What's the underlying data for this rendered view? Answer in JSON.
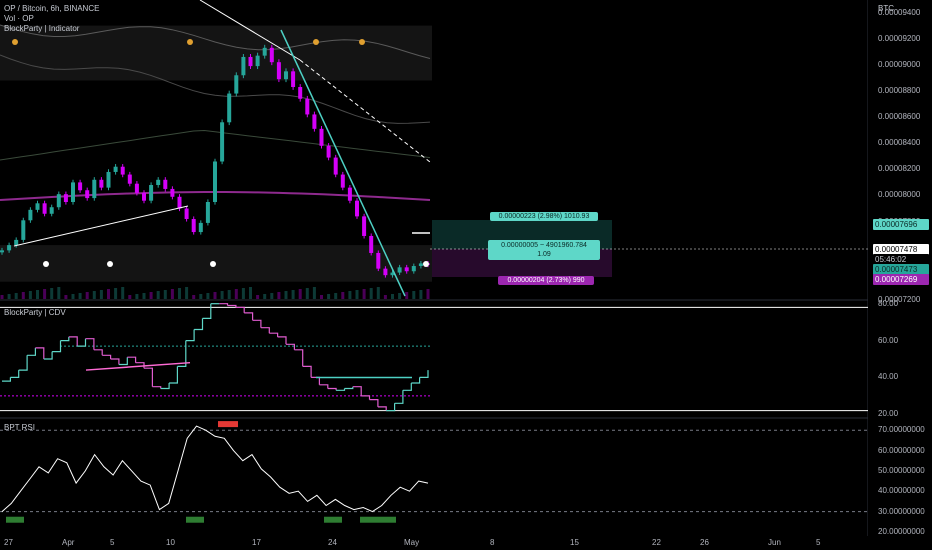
{
  "header": {
    "symbol": "OP / Bitcoin, 6h, BINANCE",
    "vol_label": "Vol · OP",
    "indicator_label": "BlockParty | Indicator",
    "currency": "BTC"
  },
  "panes": {
    "cdv_title": "BlockParty | CDV",
    "rsi_title": "BPT RSI"
  },
  "colors": {
    "bull": "#26a69a",
    "bear": "#d500f9",
    "rsi_line": "#ffffff",
    "trend_teal": "#4dd0c4",
    "ma_purple": "#8e2a8e",
    "cdv_bull": "#5ed7c8",
    "cdv_bear": "#e05ccf"
  },
  "price_axis": {
    "ticks": [
      "0.00009400",
      "0.00009200",
      "0.00009000",
      "0.00008800",
      "0.00008600",
      "0.00008400",
      "0.00008200",
      "0.00008000",
      "0.00007800",
      "0.00007600",
      "0.00007400",
      "0.00007200"
    ],
    "tags": {
      "upper_target": "0.00007696",
      "last": "0.00007478",
      "countdown": "05:46:02",
      "entry": "0.00007473",
      "stop": "0.00007269"
    }
  },
  "cdv_axis": {
    "ticks": [
      "80.00",
      "60.00",
      "40.00",
      "20.00"
    ]
  },
  "rsi_axis": {
    "ticks": [
      "70.00000000",
      "60.00000000",
      "50.00000000",
      "40.00000000",
      "30.00000000",
      "20.00000000"
    ]
  },
  "time_axis": {
    "labels": [
      "27",
      "Apr",
      "5",
      "10",
      "17",
      "24",
      "May",
      "8",
      "15",
      "22",
      "26",
      "Jun",
      "5"
    ]
  },
  "position_tool": {
    "target_text": "0.00000223 (2.98%) 1010.93",
    "center_line1": "0.00000005 ~ 4901960.784",
    "center_line2": "1.09",
    "stop_text": "0.00000204 (2.73%) 990"
  },
  "chart_data": [
    {
      "type": "line",
      "title": "OP / Bitcoin, 6h, BINANCE",
      "series": [
        {
          "name": "OP / Bitcoin",
          "values": [
            7.58e-05,
            7.62e-05,
            7.66e-05,
            7.81e-05,
            7.89e-05,
            7.94e-05,
            7.86e-05,
            7.91e-05,
            8.01e-05,
            7.95e-05,
            8.1e-05,
            8.04e-05,
            7.98e-05,
            8.12e-05,
            8.06e-05,
            8.18e-05,
            8.22e-05,
            8.16e-05,
            8.09e-05,
            8.02e-05,
            7.96e-05,
            8.08e-05,
            8.12e-05,
            8.05e-05,
            7.99e-05,
            7.9e-05,
            7.82e-05,
            7.72e-05,
            7.79e-05,
            7.95e-05,
            8.26e-05,
            8.56e-05,
            8.78e-05,
            8.92e-05,
            9.06e-05,
            8.99e-05,
            9.07e-05,
            9.13e-05,
            9.02e-05,
            8.89e-05,
            8.95e-05,
            8.83e-05,
            8.74e-05,
            8.62e-05,
            8.51e-05,
            8.38e-05,
            8.29e-05,
            8.16e-05,
            8.06e-05,
            7.96e-05,
            7.84e-05,
            7.69e-05,
            7.56e-05,
            7.44e-05,
            7.39e-05,
            7.41e-05,
            7.45e-05,
            7.42e-05,
            7.46e-05,
            7.48e-05,
            7.47e-05
          ]
        }
      ],
      "ylim": [
        7.2e-05,
        9.45e-05
      ]
    },
    {
      "type": "line",
      "title": "BlockParty | CDV",
      "series": [
        {
          "name": "CDV",
          "values": [
            38,
            40,
            44,
            52,
            56,
            50,
            54,
            60,
            62,
            57,
            61,
            55,
            52,
            50,
            47,
            51,
            48,
            45,
            35,
            34,
            37,
            46,
            60,
            66,
            72,
            80,
            80,
            79,
            78,
            75,
            71,
            67,
            64,
            62,
            58,
            55,
            46,
            40,
            36,
            34,
            33,
            34,
            35,
            30,
            28,
            24,
            22,
            26,
            33,
            37,
            40,
            44
          ]
        }
      ],
      "ylim": [
        18,
        82
      ]
    },
    {
      "type": "line",
      "title": "BPT RSI",
      "series": [
        {
          "name": "RSI",
          "values": [
            30,
            34,
            40,
            46,
            52,
            49,
            56,
            54,
            44,
            50,
            58,
            52,
            48,
            55,
            50,
            45,
            43,
            31,
            34,
            50,
            66,
            72,
            70,
            67,
            66,
            60,
            55,
            58,
            51,
            47,
            42,
            39,
            40,
            35,
            38,
            33,
            36,
            33,
            31,
            32,
            30,
            33,
            38,
            42,
            40,
            45,
            44
          ]
        }
      ],
      "ylim": [
        18,
        76
      ]
    }
  ]
}
